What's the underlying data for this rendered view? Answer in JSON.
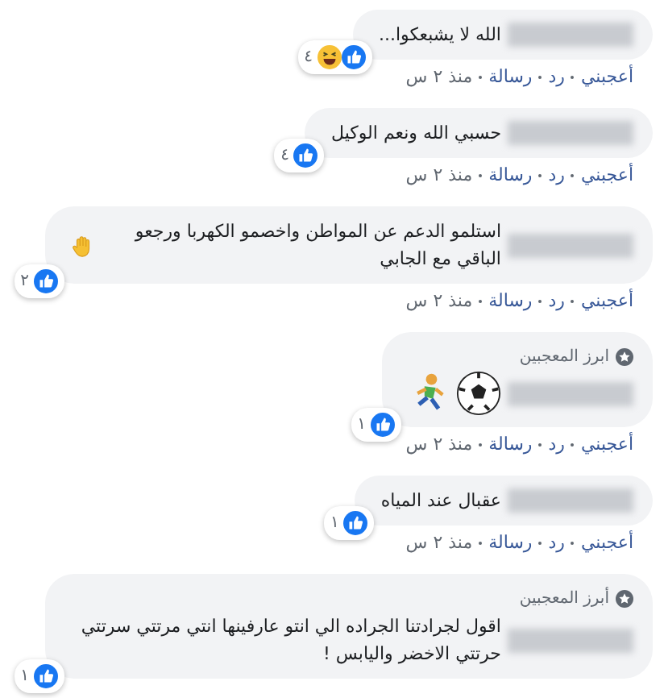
{
  "comments": [
    {
      "text": "الله لا يشبعكوا...",
      "reactions": [
        {
          "kind": "like"
        },
        {
          "kind": "haha"
        }
      ],
      "count": "٤",
      "actions": [
        "أعجبني",
        "رد",
        "رسالة"
      ],
      "time": "منذ ٢ س"
    },
    {
      "text": "حسبي الله ونعم الوكيل",
      "reactions": [
        {
          "kind": "like"
        }
      ],
      "count": "٤",
      "actions": [
        "أعجبني",
        "رد",
        "رسالة"
      ],
      "time": "منذ ٢ س"
    },
    {
      "text": "استلمو الدعم عن المواطن واخصمو الكهربا ورجعو الباقي مع الجابي",
      "emojis": [
        {
          "kind": "hand"
        }
      ],
      "reactions": [
        {
          "kind": "like"
        }
      ],
      "count": "٢",
      "actions": [
        "أعجبني",
        "رد",
        "رسالة"
      ],
      "time": "منذ ٢ س"
    },
    {
      "badge": "ابرز المعجبين",
      "emojis": [
        {
          "kind": "ball"
        },
        {
          "kind": "runner"
        }
      ],
      "reactions": [
        {
          "kind": "like"
        }
      ],
      "count": "١",
      "actions": [
        "أعجبني",
        "رد",
        "رسالة"
      ],
      "time": "منذ ٢ س"
    },
    {
      "text": "عقبال عند المياه",
      "reactions": [
        {
          "kind": "like"
        }
      ],
      "count": "١",
      "actions": [
        "أعجبني",
        "رد",
        "رسالة"
      ],
      "time": "منذ ٢ س"
    },
    {
      "badge": "أبرز المعجبين",
      "text": "اقول لجرادتنا الجراده الي انتو عارفينها انتي مرتتي سرتتي حرتتي الاخضر واليابس !",
      "reactions": [
        {
          "kind": "like"
        }
      ],
      "count": "١"
    }
  ]
}
